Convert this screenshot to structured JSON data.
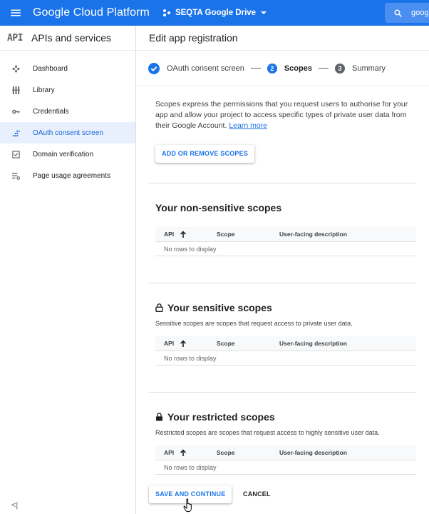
{
  "topbar": {
    "brand": "Google Cloud Platform",
    "project": "SEQTA Google Drive",
    "search_text": "goog",
    "color": "#1a73e8"
  },
  "sidebar": {
    "logo": "API",
    "title": "APIs and services",
    "items": [
      {
        "label": "Dashboard",
        "icon": "dashboard-icon"
      },
      {
        "label": "Library",
        "icon": "library-icon"
      },
      {
        "label": "Credentials",
        "icon": "key-icon"
      },
      {
        "label": "OAuth consent screen",
        "icon": "oauth-icon",
        "active": true
      },
      {
        "label": "Domain verification",
        "icon": "checkbox-icon"
      },
      {
        "label": "Page usage agreements",
        "icon": "settings-list-icon"
      }
    ],
    "collapse_icon": "collapse-icon",
    "collapse_label": "<|"
  },
  "main": {
    "title": "Edit app registration",
    "steps": [
      {
        "label": "OAuth consent screen",
        "state": "done"
      },
      {
        "number": "2",
        "label": "Scopes",
        "state": "active"
      },
      {
        "number": "3",
        "label": "Summary",
        "state": "pending"
      }
    ],
    "intro_text": "Scopes express the permissions that you request users to authorise for your app and allow your project to access specific types of private user data from their Google Account.",
    "learn_more": "Learn more",
    "add_scopes_button": "ADD OR REMOVE SCOPES",
    "sections": [
      {
        "title": "Your non-sensitive scopes",
        "description": "",
        "columns": [
          "API",
          "Scope",
          "User-facing description"
        ],
        "empty": "No rows to display"
      },
      {
        "title": "Your sensitive scopes",
        "description": "Sensitive scopes are scopes that request access to private user data.",
        "columns": [
          "API",
          "Scope",
          "User-facing description"
        ],
        "empty": "No rows to display"
      },
      {
        "title": "Your restricted scopes",
        "description": "Restricted scopes are scopes that request access to highly sensitive user data.",
        "columns": [
          "API",
          "Scope",
          "User-facing description"
        ],
        "empty": "No rows to display"
      }
    ],
    "save_button": "SAVE AND CONTINUE",
    "cancel_button": "CANCEL"
  }
}
